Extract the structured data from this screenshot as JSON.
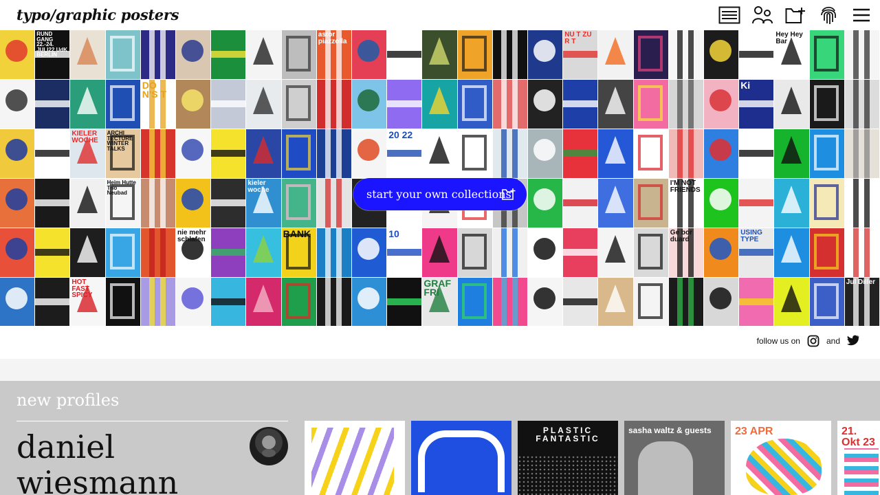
{
  "header": {
    "logo": "typo/graphic posters",
    "icons": [
      "list-view-icon",
      "profiles-icon",
      "add-collection-icon",
      "fingerprint-icon",
      "menu-icon"
    ]
  },
  "posters": {
    "columns": 25,
    "rows": 6,
    "tiles": [
      {
        "bg": "#f2d23a",
        "fg": "#e23b2e",
        "t": ""
      },
      {
        "bg": "#111111",
        "fg": "#ffffff",
        "t": "RUND GANG 22.-24. JULI22 UdK BERLIN"
      },
      {
        "bg": "#e9e1d3",
        "fg": "#d98454",
        "t": ""
      },
      {
        "bg": "#7ec3c9",
        "fg": "#ffffff",
        "t": ""
      },
      {
        "bg": "#2c2a85",
        "fg": "#ffffff",
        "t": ""
      },
      {
        "bg": "#d9c7b2",
        "fg": "#2b3b8f",
        "t": ""
      },
      {
        "bg": "#1b8f3b",
        "fg": "#f7e43a",
        "t": ""
      },
      {
        "bg": "#f4f4f4",
        "fg": "#222",
        "t": ""
      },
      {
        "bg": "#bdbdbd",
        "fg": "#333",
        "t": ""
      },
      {
        "bg": "#e85a2d",
        "fg": "#ffffff",
        "t": "astor piazzolla"
      },
      {
        "bg": "#e43f55",
        "fg": "#1f5da8",
        "t": ""
      },
      {
        "bg": "#ffffff",
        "fg": "#111",
        "t": ""
      },
      {
        "bg": "#3b4f2d",
        "fg": "#cfd86a",
        "t": ""
      },
      {
        "bg": "#f0a329",
        "fg": "#1a1a1a",
        "t": ""
      },
      {
        "bg": "#111111",
        "fg": "#ffffff",
        "t": ""
      },
      {
        "bg": "#1f3a8c",
        "fg": "#ffffff",
        "t": ""
      },
      {
        "bg": "#d9d9d9",
        "fg": "#e1322e",
        "t": "NU T ZU R T"
      },
      {
        "bg": "#f2f2f2",
        "fg": "#f26b1f",
        "t": ""
      },
      {
        "bg": "#2a1e4f",
        "fg": "#e9417f",
        "t": ""
      },
      {
        "bg": "#f7f7f7",
        "fg": "#111",
        "t": ""
      },
      {
        "bg": "#1c1c1c",
        "fg": "#f4d538",
        "t": ""
      },
      {
        "bg": "#ffffff",
        "fg": "#111",
        "t": ""
      },
      {
        "bg": "#ffffff",
        "fg": "#111",
        "t": "Hey Hey Bar"
      },
      {
        "bg": "#37d67a",
        "fg": "#111",
        "t": ""
      },
      {
        "bg": "#f5f5f5",
        "fg": "#333",
        "t": ""
      },
      {
        "bg": "#f5f5f5",
        "fg": "#333",
        "t": ""
      },
      {
        "bg": "#1b2d63",
        "fg": "#ffffff",
        "t": ""
      },
      {
        "bg": "#2a9d7a",
        "fg": "#ffffff",
        "t": ""
      },
      {
        "bg": "#1f4fb3",
        "fg": "#ffffff",
        "t": ""
      },
      {
        "bg": "#ffffff",
        "fg": "#e7a21b",
        "t": "DO N'S T"
      },
      {
        "bg": "#b2875a",
        "fg": "#f5e36a",
        "t": ""
      },
      {
        "bg": "#c3c9d6",
        "fg": "#ffffff",
        "t": ""
      },
      {
        "bg": "#e7ebee",
        "fg": "#333",
        "t": ""
      },
      {
        "bg": "#cfcfcf",
        "fg": "#333",
        "t": ""
      },
      {
        "bg": "#d12d2d",
        "fg": "#ffffff",
        "t": ""
      },
      {
        "bg": "#7ec4e8",
        "fg": "#1d6a3a",
        "t": ""
      },
      {
        "bg": "#8e6bf0",
        "fg": "#ffffff",
        "t": ""
      },
      {
        "bg": "#16a4a4",
        "fg": "#f2d42f",
        "t": ""
      },
      {
        "bg": "#2f5cc7",
        "fg": "#ffffff",
        "t": ""
      },
      {
        "bg": "#e36b6b",
        "fg": "#ffffff",
        "t": ""
      },
      {
        "bg": "#222222",
        "fg": "#ffffff",
        "t": ""
      },
      {
        "bg": "#1e3ea8",
        "fg": "#ffffff",
        "t": ""
      },
      {
        "bg": "#444444",
        "fg": "#ffffff",
        "t": ""
      },
      {
        "bg": "#f26ba1",
        "fg": "#f7e23a",
        "t": ""
      },
      {
        "bg": "#d6d6d6",
        "fg": "#555",
        "t": ""
      },
      {
        "bg": "#f3b2c2",
        "fg": "#d9323a",
        "t": ""
      },
      {
        "bg": "#1e2e8e",
        "fg": "#ffffff",
        "t": "Ki"
      },
      {
        "bg": "#e9e9e9",
        "fg": "#111",
        "t": ""
      },
      {
        "bg": "#1a1a1a",
        "fg": "#ffffff",
        "t": ""
      },
      {
        "bg": "#dcdcdc",
        "fg": "#333",
        "t": ""
      },
      {
        "bg": "#f0c93c",
        "fg": "#1f3aa0",
        "t": ""
      },
      {
        "bg": "#ffffff",
        "fg": "#111",
        "t": ""
      },
      {
        "bg": "#dfe7ee",
        "fg": "#e02e2e",
        "t": "KIELER WOCHE"
      },
      {
        "bg": "#e7c9a0",
        "fg": "#111",
        "t": "ARCHI TECTURE WINTER TALKS"
      },
      {
        "bg": "#d7352c",
        "fg": "#f6d23a",
        "t": ""
      },
      {
        "bg": "#f7f7f7",
        "fg": "#3a4fb3",
        "t": ""
      },
      {
        "bg": "#f4e22d",
        "fg": "#111",
        "t": ""
      },
      {
        "bg": "#2b47a6",
        "fg": "#d92b2b",
        "t": ""
      },
      {
        "bg": "#1f4bc4",
        "fg": "#f7d531",
        "t": ""
      },
      {
        "bg": "#1d3f93",
        "fg": "#ffffff",
        "t": ""
      },
      {
        "bg": "#f5f5f5",
        "fg": "#e04b23",
        "t": ""
      },
      {
        "bg": "#ffffff",
        "fg": "#1e4cb0",
        "t": "20 22"
      },
      {
        "bg": "#ffffff",
        "fg": "#111",
        "t": ""
      },
      {
        "bg": "#ffffff",
        "fg": "#111",
        "t": ""
      },
      {
        "bg": "#dfe9ee",
        "fg": "#1f4fb3",
        "t": ""
      },
      {
        "bg": "#a8b5b9",
        "fg": "#ffffff",
        "t": ""
      },
      {
        "bg": "#e7323c",
        "fg": "#2a9b3d",
        "t": ""
      },
      {
        "bg": "#2458d6",
        "fg": "#ffffff",
        "t": ""
      },
      {
        "bg": "#ffffff",
        "fg": "#d81f26",
        "t": ""
      },
      {
        "bg": "#f2b9b9",
        "fg": "#e02e2e",
        "t": ""
      },
      {
        "bg": "#2f7fe0",
        "fg": "#e02e2e",
        "t": ""
      },
      {
        "bg": "#ffffff",
        "fg": "#111",
        "t": ""
      },
      {
        "bg": "#16b32c",
        "fg": "#111",
        "t": ""
      },
      {
        "bg": "#1e8fe0",
        "fg": "#ffffff",
        "t": ""
      },
      {
        "bg": "#e5e1d8",
        "fg": "#888",
        "t": ""
      },
      {
        "bg": "#e8703a",
        "fg": "#1f3fa1",
        "t": ""
      },
      {
        "bg": "#1a1a1a",
        "fg": "#ffffff",
        "t": ""
      },
      {
        "bg": "#f0f0f0",
        "fg": "#111",
        "t": ""
      },
      {
        "bg": "#f5f5f5",
        "fg": "#111",
        "t": "Heim Hutte Trio Neubad"
      },
      {
        "bg": "#c78b70",
        "fg": "#fff",
        "t": ""
      },
      {
        "bg": "#f2c21b",
        "fg": "#2146b3",
        "t": ""
      },
      {
        "bg": "#2d2d2d",
        "fg": "#ffffff",
        "t": ""
      },
      {
        "bg": "#2f8fd0",
        "fg": "#ffffff",
        "t": "kieler woche"
      },
      {
        "bg": "#44b58a",
        "fg": "#f7b9d1",
        "t": ""
      },
      {
        "bg": "#e4e4e4",
        "fg": "#d62e2e",
        "t": ""
      },
      {
        "bg": "#222222",
        "fg": "#ffffff",
        "t": ""
      },
      {
        "bg": "#ffffff",
        "fg": "#111",
        "t": ""
      },
      {
        "bg": "#f4f4f4",
        "fg": "#111",
        "t": ""
      },
      {
        "bg": "#ffffff",
        "fg": "#e02626",
        "t": ""
      },
      {
        "bg": "#c6c6c6",
        "fg": "#333",
        "t": ""
      },
      {
        "bg": "#27b648",
        "fg": "#ffffff",
        "t": ""
      },
      {
        "bg": "#f2f2f2",
        "fg": "#d61f2b",
        "t": ""
      },
      {
        "bg": "#3e6ee0",
        "fg": "#ffffff",
        "t": ""
      },
      {
        "bg": "#c8b590",
        "fg": "#d02a2a",
        "t": ""
      },
      {
        "bg": "#ffffff",
        "fg": "#111",
        "t": "I'M NOT FRIENDS"
      },
      {
        "bg": "#1ec31e",
        "fg": "#ffffff",
        "t": ""
      },
      {
        "bg": "#f4f4f4",
        "fg": "#e02e2e",
        "t": ""
      },
      {
        "bg": "#2bb0d8",
        "fg": "#ffffff",
        "t": ""
      },
      {
        "bg": "#f6e9b8",
        "fg": "#1e2a8e",
        "t": ""
      },
      {
        "bg": "#ffffff",
        "fg": "#111",
        "t": ""
      },
      {
        "bg": "#e8503a",
        "fg": "#1f3fa1",
        "t": ""
      },
      {
        "bg": "#f4e22d",
        "fg": "#111",
        "t": ""
      },
      {
        "bg": "#1e1e1e",
        "fg": "#ffffff",
        "t": ""
      },
      {
        "bg": "#38a5e5",
        "fg": "#ffffff",
        "t": ""
      },
      {
        "bg": "#e2552d",
        "fg": "#c21d1d",
        "t": ""
      },
      {
        "bg": "#ffffff",
        "fg": "#111",
        "t": "nie mehr schlafen"
      },
      {
        "bg": "#8e3fbd",
        "fg": "#2fb85f",
        "t": ""
      },
      {
        "bg": "#37bfe0",
        "fg": "#8ed33c",
        "t": ""
      },
      {
        "bg": "#f2d21b",
        "fg": "#111",
        "t": "BANK"
      },
      {
        "bg": "#1a7fc5",
        "fg": "#ffffff",
        "t": ""
      },
      {
        "bg": "#1f5bd2",
        "fg": "#ffffff",
        "t": ""
      },
      {
        "bg": "#ffffff",
        "fg": "#1d4bc0",
        "t": "10"
      },
      {
        "bg": "#ef3a8a",
        "fg": "#111",
        "t": ""
      },
      {
        "bg": "#d7d7d7",
        "fg": "#111",
        "t": ""
      },
      {
        "bg": "#f0f0f0",
        "fg": "#1d6be0",
        "t": ""
      },
      {
        "bg": "#ffffff",
        "fg": "#111",
        "t": ""
      },
      {
        "bg": "#e83f5f",
        "fg": "#ffffff",
        "t": ""
      },
      {
        "bg": "#f4f4f4",
        "fg": "#111",
        "t": ""
      },
      {
        "bg": "#d9d9d9",
        "fg": "#111",
        "t": ""
      },
      {
        "bg": "#f8d8d8",
        "fg": "#111",
        "t": "Ge bor duard"
      },
      {
        "bg": "#f08a1c",
        "fg": "#1e58c5",
        "t": ""
      },
      {
        "bg": "#e9e9e9",
        "fg": "#1f4fb3",
        "t": "USING TYPE"
      },
      {
        "bg": "#1e8fe0",
        "fg": "#ffffff",
        "t": ""
      },
      {
        "bg": "#d43030",
        "fg": "#f7d21b",
        "t": ""
      },
      {
        "bg": "#ffffff",
        "fg": "#d43030",
        "t": ""
      },
      {
        "bg": "#2d74c7",
        "fg": "#ffffff",
        "t": ""
      },
      {
        "bg": "#1c1c1c",
        "fg": "#ffffff",
        "t": ""
      },
      {
        "bg": "#f6f6f6",
        "fg": "#d81f26",
        "t": "HOT FAST SPICY"
      },
      {
        "bg": "#111111",
        "fg": "#ffffff",
        "t": ""
      },
      {
        "bg": "#a99be3",
        "fg": "#f4e22d",
        "t": ""
      },
      {
        "bg": "#f5f5f5",
        "fg": "#5e5ad8",
        "t": ""
      },
      {
        "bg": "#37b6e0",
        "fg": "#111",
        "t": ""
      },
      {
        "bg": "#d42a6b",
        "fg": "#f2b2c7",
        "t": ""
      },
      {
        "bg": "#1f9e4b",
        "fg": "#e02626",
        "t": ""
      },
      {
        "bg": "#1a1a1a",
        "fg": "#ffffff",
        "t": ""
      },
      {
        "bg": "#2d8fd6",
        "fg": "#ffffff",
        "t": ""
      },
      {
        "bg": "#111",
        "fg": "#2fd85f",
        "t": ""
      },
      {
        "bg": "#e8e8e8",
        "fg": "#1f7f3f",
        "t": "GRAF FRI"
      },
      {
        "bg": "#1e7fe0",
        "fg": "#2fd85f",
        "t": ""
      },
      {
        "bg": "#f24a8f",
        "fg": "#3db4e0",
        "t": ""
      },
      {
        "bg": "#f5f5f5",
        "fg": "#111",
        "t": ""
      },
      {
        "bg": "#e7e7e7",
        "fg": "#111",
        "t": ""
      },
      {
        "bg": "#d9b98c",
        "fg": "#fff",
        "t": ""
      },
      {
        "bg": "#f4f4f4",
        "fg": "#111",
        "t": ""
      },
      {
        "bg": "#1b1b1b",
        "fg": "#2fb84a",
        "t": ""
      },
      {
        "bg": "#d8d8d8",
        "fg": "#111",
        "t": ""
      },
      {
        "bg": "#f06bb0",
        "fg": "#f7d21b",
        "t": ""
      },
      {
        "bg": "#e4ef22",
        "fg": "#111",
        "t": ""
      },
      {
        "bg": "#3b5fc7",
        "fg": "#ffffff",
        "t": ""
      },
      {
        "bg": "#222",
        "fg": "#ffffff",
        "t": "Jul Diller"
      }
    ]
  },
  "cta": {
    "label": "start your own collections"
  },
  "follow": {
    "text": "follow us on",
    "and": "and"
  },
  "profiles": {
    "title": "new profiles",
    "name": "daniel wiesmann",
    "thumbs": [
      {
        "bg": "#ffffff",
        "fg": "#7b4fe0",
        "t": ""
      },
      {
        "bg": "#1f4fe0",
        "fg": "#ffffff",
        "t": ""
      },
      {
        "bg": "#111111",
        "fg": "#ffffff",
        "t": "PLASTIC FANTASTIC"
      },
      {
        "bg": "#6a6a6a",
        "fg": "#ffffff",
        "t": "sasha waltz & guests"
      },
      {
        "bg": "#ffffff",
        "fg": "#f26b3a",
        "t": "23 APR"
      },
      {
        "bg": "#ffffff",
        "fg": "#e02e2e",
        "t": "21. Okt 23"
      }
    ]
  }
}
